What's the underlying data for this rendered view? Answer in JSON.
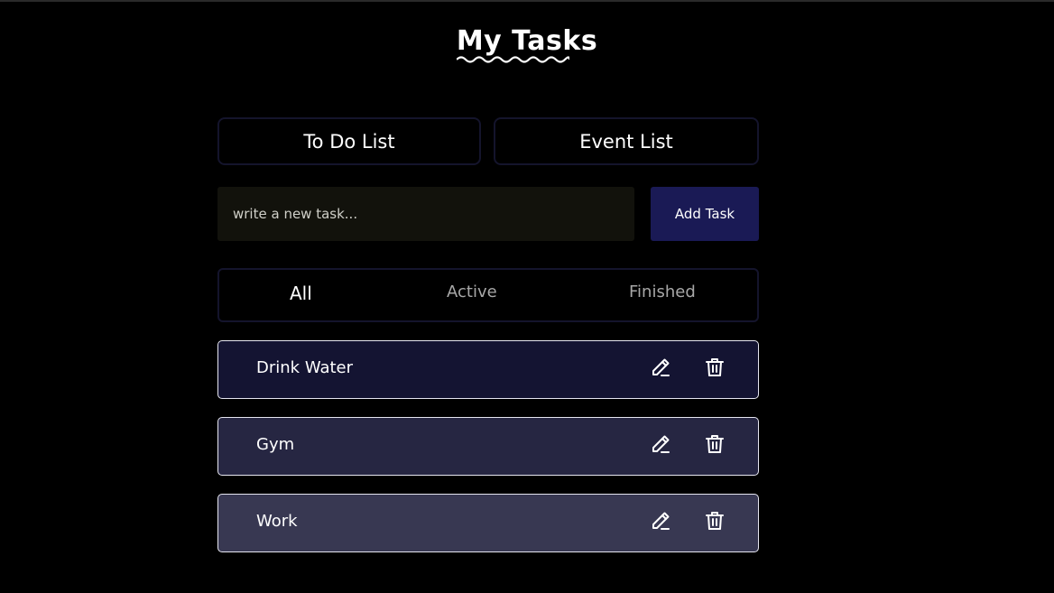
{
  "header": {
    "title": "My Tasks"
  },
  "list_tabs": [
    {
      "label": "To Do List"
    },
    {
      "label": "Event List"
    }
  ],
  "new_task": {
    "placeholder": "write a new task...",
    "value": "",
    "add_label": "Add Task"
  },
  "filters": [
    {
      "label": "All",
      "selected": true
    },
    {
      "label": "Active",
      "selected": false
    },
    {
      "label": "Finished",
      "selected": false
    }
  ],
  "tasks": [
    {
      "label": "Drink Water",
      "edit_icon": "pencil-icon",
      "delete_icon": "trash-icon"
    },
    {
      "label": "Gym",
      "edit_icon": "pencil-icon",
      "delete_icon": "trash-icon"
    },
    {
      "label": "Work",
      "edit_icon": "pencil-icon",
      "delete_icon": "trash-icon"
    }
  ],
  "colors": {
    "background": "#000000",
    "accent": "#1a1a55",
    "task_row_1": "#141432",
    "task_row_2": "#262642",
    "task_row_3": "#383852",
    "input_bg": "#12120c"
  }
}
